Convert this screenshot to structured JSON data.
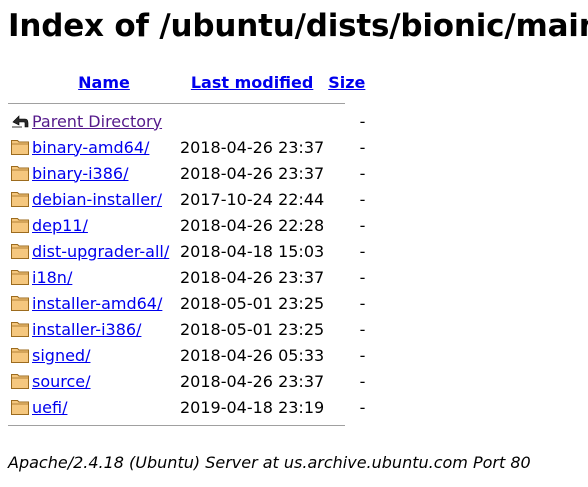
{
  "page": {
    "title": "Index of /ubuntu/dists/bionic/main"
  },
  "table": {
    "headers": {
      "name": "Name",
      "last_modified": "Last modified",
      "size": "Size"
    },
    "parent": {
      "label": "Parent Directory",
      "size": "-",
      "icon": "back-arrow-icon"
    },
    "rows": [
      {
        "name": "binary-amd64/",
        "date": "2018-04-26 23:37",
        "size": "-",
        "icon": "folder-icon"
      },
      {
        "name": "binary-i386/",
        "date": "2018-04-26 23:37",
        "size": "-",
        "icon": "folder-icon"
      },
      {
        "name": "debian-installer/",
        "date": "2017-10-24 22:44",
        "size": "-",
        "icon": "folder-icon"
      },
      {
        "name": "dep11/",
        "date": "2018-04-26 22:28",
        "size": "-",
        "icon": "folder-icon"
      },
      {
        "name": "dist-upgrader-all/",
        "date": "2018-04-18 15:03",
        "size": "-",
        "icon": "folder-icon"
      },
      {
        "name": "i18n/",
        "date": "2018-04-26 23:37",
        "size": "-",
        "icon": "folder-icon"
      },
      {
        "name": "installer-amd64/",
        "date": "2018-05-01 23:25",
        "size": "-",
        "icon": "folder-icon"
      },
      {
        "name": "installer-i386/",
        "date": "2018-05-01 23:25",
        "size": "-",
        "icon": "folder-icon"
      },
      {
        "name": "signed/",
        "date": "2018-04-26 05:33",
        "size": "-",
        "icon": "folder-icon"
      },
      {
        "name": "source/",
        "date": "2018-04-26 23:37",
        "size": "-",
        "icon": "folder-icon"
      },
      {
        "name": "uefi/",
        "date": "2019-04-18 23:19",
        "size": "-",
        "icon": "folder-icon"
      }
    ]
  },
  "footer": {
    "address": "Apache/2.4.18 (Ubuntu) Server at us.archive.ubuntu.com Port 80"
  },
  "colors": {
    "link": "#0000ee",
    "visited_link": "#551a8b",
    "folder_fill": "#f5c77e",
    "folder_stroke": "#9c6b1e",
    "rule": "#a0a0a0"
  }
}
